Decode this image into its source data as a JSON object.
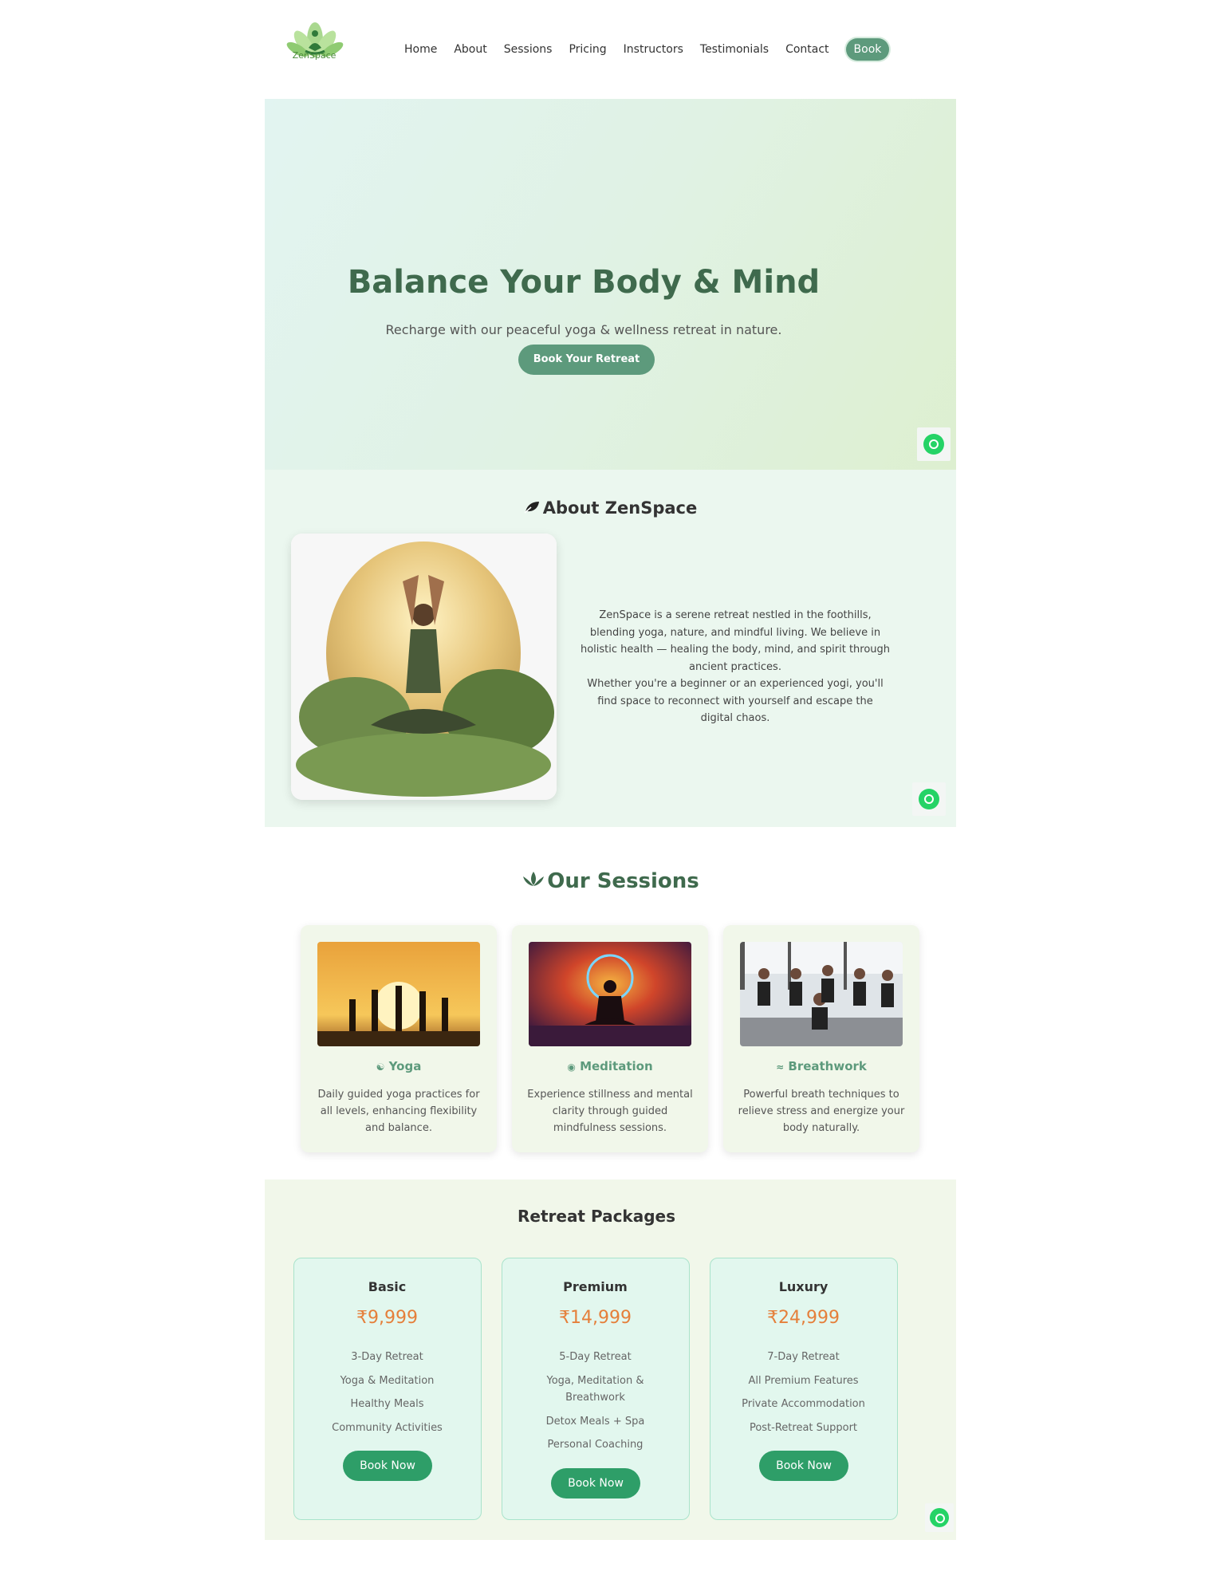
{
  "brand": {
    "name": "ZenSpace",
    "accent": "#5d9a7c",
    "price_color": "#e57f3a",
    "whatsapp_color": "#25d366"
  },
  "nav": {
    "links": [
      "Home",
      "About",
      "Sessions",
      "Pricing",
      "Instructors",
      "Testimonials",
      "Contact"
    ],
    "book_label": "Book"
  },
  "hero": {
    "title": "Balance Your Body & Mind",
    "subtitle": "Recharge with our peaceful yoga & wellness retreat in nature.",
    "cta": "Book Your Retreat"
  },
  "about": {
    "title": "About ZenSpace",
    "title_icon": "leaf-icon",
    "paragraph1": "ZenSpace is a serene retreat nestled in the foothills, blending yoga, nature, and mindful living. We believe in holistic health — healing the body, mind, and spirit through ancient practices.",
    "paragraph2": "Whether you're a beginner or an experienced yogi, you'll find space to reconnect with yourself and escape the digital chaos."
  },
  "sessions": {
    "title": "Our Sessions",
    "title_icon": "lotus-icon",
    "items": [
      {
        "title": "Yoga",
        "icon": "person-icon",
        "desc": "Daily guided yoga practices for all levels, enhancing flexibility and balance."
      },
      {
        "title": "Meditation",
        "icon": "brain-icon",
        "desc": "Experience stillness and mental clarity through guided mindfulness sessions."
      },
      {
        "title": "Breathwork",
        "icon": "wind-icon",
        "desc": "Powerful breath techniques to relieve stress and energize your body naturally."
      }
    ]
  },
  "packages": {
    "title": "Retreat Packages",
    "items": [
      {
        "name": "Basic",
        "price": "₹9,999",
        "features": [
          "3-Day Retreat",
          "Yoga & Meditation",
          "Healthy Meals",
          "Community Activities"
        ],
        "cta": "Book Now"
      },
      {
        "name": "Premium",
        "price": "₹14,999",
        "features": [
          "5-Day Retreat",
          "Yoga, Meditation & Breathwork",
          "Detox Meals + Spa",
          "Personal Coaching"
        ],
        "cta": "Book Now"
      },
      {
        "name": "Luxury",
        "price": "₹24,999",
        "features": [
          "7-Day Retreat",
          "All Premium Features",
          "Private Accommodation",
          "Post-Retreat Support"
        ],
        "cta": "Book Now"
      }
    ]
  }
}
